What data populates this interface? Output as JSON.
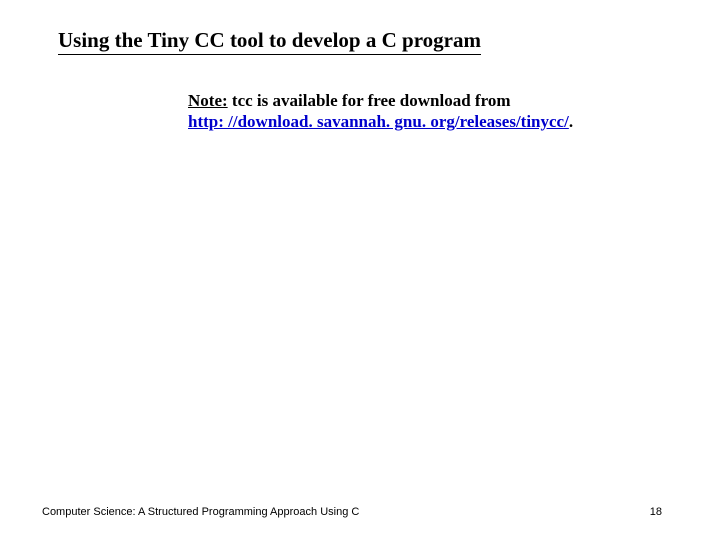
{
  "title": "Using the Tiny CC tool to develop a C program",
  "note": {
    "label": "Note:",
    "text": " tcc is available for free download from",
    "link": "http: //download. savannah. gnu. org/releases/tinycc/",
    "period": "."
  },
  "footer": {
    "left": "Computer Science: A Structured Programming Approach Using C",
    "page": "18"
  }
}
